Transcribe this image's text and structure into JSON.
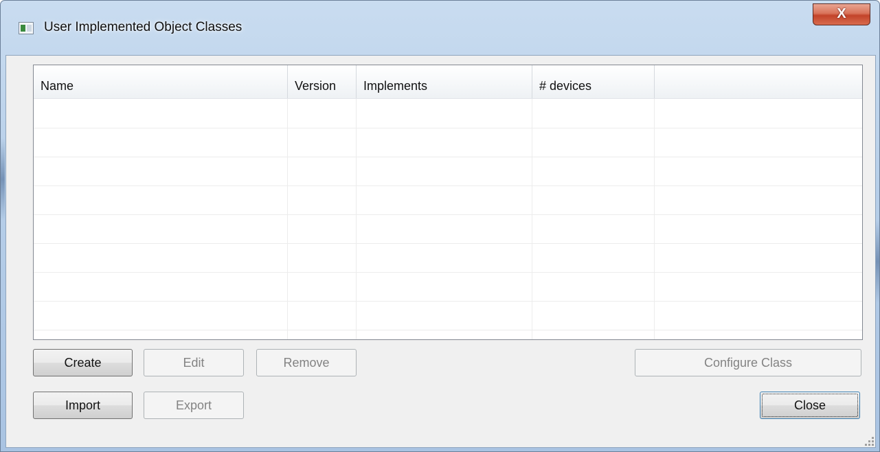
{
  "window": {
    "title": "User Implemented Object Classes",
    "close_glyph": "X",
    "app_icon": "application-window-icon"
  },
  "table": {
    "columns": [
      "Name",
      "Version",
      "Implements",
      "# devices",
      ""
    ],
    "rows": []
  },
  "buttons": {
    "create": "Create",
    "edit": "Edit",
    "remove": "Remove",
    "configure_class": "Configure Class",
    "import": "Import",
    "export": "Export",
    "close": "Close"
  },
  "colors": {
    "title_gradient_top": "#c9dcf0",
    "close_button_red": "#c2432a",
    "default_button_border": "#3c7fb1",
    "disabled_text": "#838383"
  }
}
